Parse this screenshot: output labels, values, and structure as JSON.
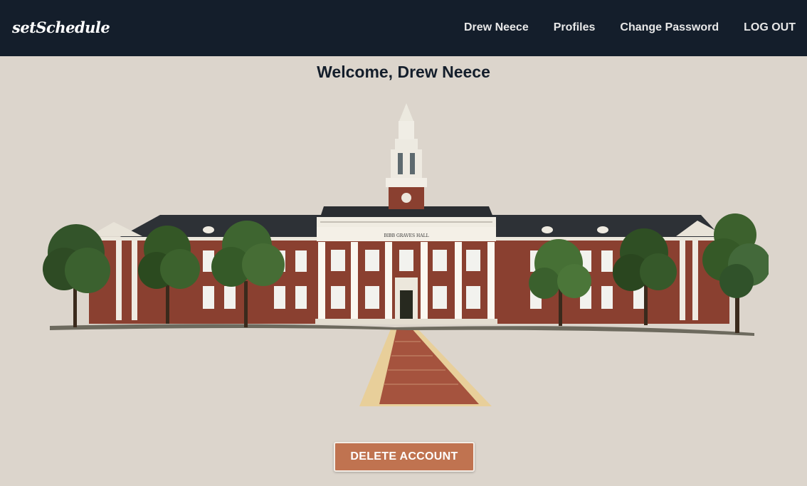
{
  "navbar": {
    "brand": "setSchedule",
    "links": [
      "Drew Neece",
      "Profiles",
      "Change Password",
      "LOG OUT"
    ]
  },
  "main": {
    "welcome": "Welcome, Drew Neece",
    "building_sign": "BIBB GRAVES HALL",
    "delete_button": "DELETE ACCOUNT"
  },
  "colors": {
    "navbar": "#141e2b",
    "background": "#dcd5cc",
    "delete_button": "#c07350"
  }
}
